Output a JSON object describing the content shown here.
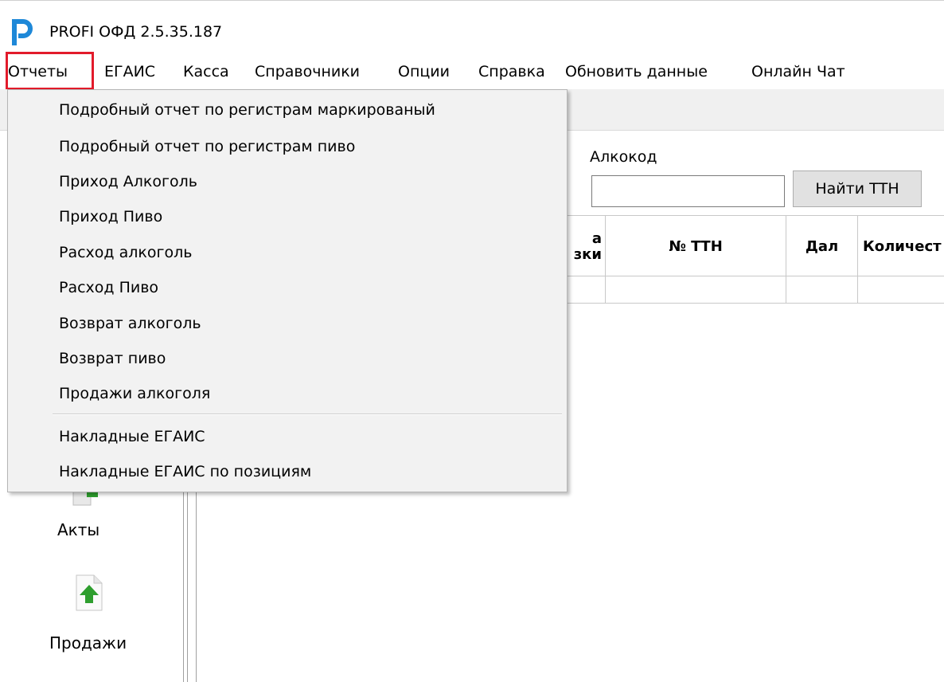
{
  "app": {
    "title": "PROFI ОФД 2.5.35.187",
    "logo_icon": "profi-p-logo-icon",
    "accent_color": "#1e88d8"
  },
  "menubar": {
    "items": [
      {
        "label": "Отчеты",
        "highlighted": true
      },
      {
        "label": "ЕГАИС"
      },
      {
        "label": "Касса"
      },
      {
        "label": "Справочники"
      },
      {
        "label": "Опции"
      },
      {
        "label": "Справка"
      },
      {
        "label": "Обновить данные"
      },
      {
        "label": "Онлайн Чат"
      }
    ],
    "highlight_color": "#e21b2b"
  },
  "reports_menu": {
    "items": [
      "Подробный отчет по регистрам маркированый",
      "Подробный отчет по регистрам пиво",
      "Приход Алкоголь",
      "Приход Пиво",
      "Расход алкоголь",
      "Расход Пиво",
      "Возврат алкоголь",
      "Возврат пиво",
      "Продажи алкоголя",
      "Накладные ЕГАИС",
      "Накладные ЕГАИС по позициям"
    ]
  },
  "filter": {
    "alcocode_label": "Алкокод",
    "alcocode_value": "",
    "find_button": "Найти ТТН"
  },
  "grid": {
    "columns": [
      "а\nзки",
      "№ ТТН",
      "Дал",
      "Количест"
    ]
  },
  "left_nav": {
    "items": [
      {
        "label": "Акты",
        "icon": "upload-arrow-icon"
      },
      {
        "label": "Продажи",
        "icon": "document-upload-icon"
      }
    ]
  }
}
